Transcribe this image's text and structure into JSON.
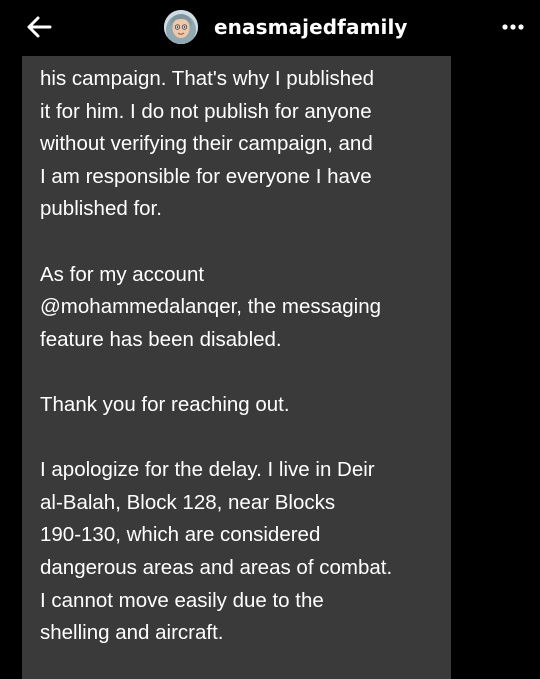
{
  "header": {
    "blog_name": "enasmajedfamily",
    "back_icon": "arrow-left-icon",
    "more_icon": "ellipsis-icon"
  },
  "message": {
    "paragraphs": [
      {
        "lines": [
          "his campaign. That's why I published",
          "it for him. I do not publish for anyone",
          "without verifying their campaign, and",
          "I am responsible for everyone I have",
          "published for."
        ]
      },
      {
        "lines": [
          "As for my account",
          "@mohammedalanqer, the messaging",
          "feature has been disabled."
        ]
      },
      {
        "lines": [
          "Thank you for reaching out."
        ]
      },
      {
        "lines": [
          "I apologize for the delay. I live in Deir",
          "al-Balah, Block 128, near Blocks",
          "190-130, which are considered",
          "dangerous areas and areas of combat.",
          "I cannot move easily due to the",
          "shelling and aircraft."
        ]
      }
    ]
  },
  "colors": {
    "background": "#000000",
    "bubble": "#3a3a3a",
    "text": "#ffffff"
  }
}
